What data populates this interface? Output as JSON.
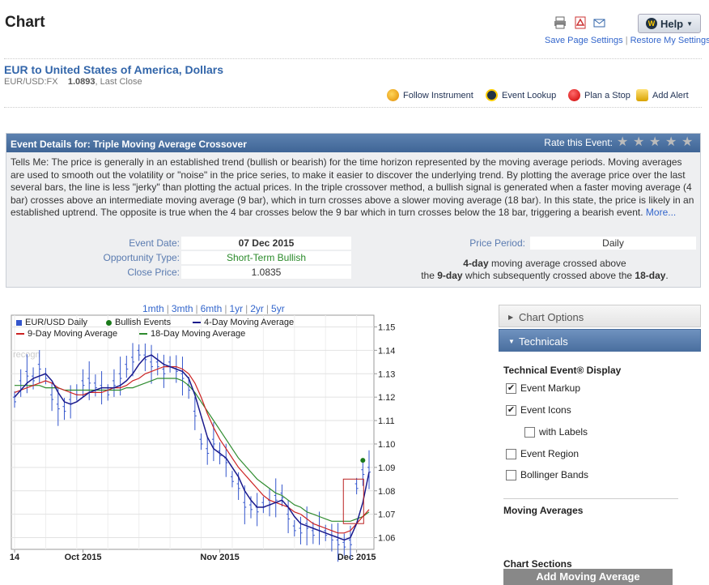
{
  "page": {
    "title": "Chart",
    "help_label": "Help",
    "save_settings": "Save Page Settings",
    "restore_settings": "Restore My Settings",
    "separator": "|"
  },
  "instrument": {
    "name": "EUR to United States of America, Dollars",
    "symbol": "EUR/USD:FX",
    "price": "1.0893",
    "price_note": ", Last Close"
  },
  "actions": [
    {
      "label": "Follow Instrument",
      "icon": "follow-icon"
    },
    {
      "label": "Event Lookup",
      "icon": "event-lookup-icon"
    },
    {
      "label": "Plan a Stop",
      "icon": "stop-icon"
    },
    {
      "label": "Add Alert",
      "icon": "alert-bell-icon"
    }
  ],
  "event": {
    "header": "Event Details for: Triple Moving Average Crossover",
    "rate_label": "Rate this Event:",
    "description": "Tells Me: The price is generally in an established trend (bullish or bearish) for the time horizon represented by the moving average periods. Moving averages are used to smooth out the volatility or \"noise\" in the price series, to make it easier to discover the underlying trend. By plotting the average price over the last several bars, the line is less \"jerky\" than plotting the actual prices. In the triple crossover method, a bullish signal is generated when a faster moving average (4 bar) crosses above an intermediate moving average (9 bar), which in turn crosses above a slower moving average (18 bar). In this state, the price is likely in an established uptrend. The opposite is true when the 4 bar crosses below the 9 bar which in turn crosses below the 18 bar, triggering a bearish event.",
    "more": "More...",
    "fields": {
      "date_label": "Event Date:",
      "date": "07 Dec 2015",
      "opp_label": "Opportunity Type:",
      "opp": "Short-Term Bullish",
      "close_label": "Close Price:",
      "close": "1.0835",
      "period_label": "Price Period:",
      "period": "Daily"
    },
    "summary": {
      "p1": "4-day",
      "t1": " moving average crossed above",
      "t2": "the ",
      "p2": "9-day",
      "t3": " which subsequently crossed above the ",
      "p3": "18-day",
      "t4": "."
    }
  },
  "ranges": [
    "1mth",
    "3mth",
    "6mth",
    "1yr",
    "2yr",
    "5yr"
  ],
  "legend": [
    "EUR/USD Daily",
    "Bullish Events",
    "4-Day Moving Average",
    "9-Day Moving Average",
    "18-Day Moving Average"
  ],
  "colors": {
    "price": "#3355cc",
    "ma4": "#1a1a8c",
    "ma9": "#cc2222",
    "ma18": "#2e8b2e",
    "event": "#1a7a1a"
  },
  "chart_data": {
    "type": "line",
    "y_ticks": [
      "1.15",
      "1.14",
      "1.13",
      "1.12",
      "1.11",
      "1.10",
      "1.09",
      "1.08",
      "1.07",
      "1.06"
    ],
    "ylim": [
      1.055,
      1.155
    ],
    "x_ticks": [
      {
        "label": "14",
        "i": 0
      },
      {
        "label": "Oct 2015",
        "i": 11
      },
      {
        "label": "Nov 2015",
        "i": 33
      },
      {
        "label": "Dec 2015",
        "i": 55
      }
    ],
    "watermark": "recogn",
    "series": [
      {
        "name": "EUR/USD Daily",
        "values": [
          1.119,
          1.126,
          1.13,
          1.128,
          1.133,
          1.129,
          1.12,
          1.116,
          1.115,
          1.118,
          1.122,
          1.126,
          1.127,
          1.125,
          1.124,
          1.122,
          1.126,
          1.129,
          1.133,
          1.136,
          1.139,
          1.137,
          1.134,
          1.134,
          1.131,
          1.134,
          1.132,
          1.129,
          1.124,
          1.113,
          1.101,
          1.097,
          1.101,
          1.096,
          1.093,
          1.085,
          1.082,
          1.074,
          1.073,
          1.072,
          1.074,
          1.075,
          1.077,
          1.078,
          1.069,
          1.064,
          1.063,
          1.065,
          1.062,
          1.064,
          1.062,
          1.06,
          1.058,
          1.057,
          1.058,
          1.082,
          1.088,
          1.089
        ]
      },
      {
        "name": "4-Day Moving Average",
        "values": [
          1.12,
          1.123,
          1.126,
          1.128,
          1.129,
          1.13,
          1.127,
          1.122,
          1.118,
          1.117,
          1.118,
          1.12,
          1.122,
          1.123,
          1.124,
          1.124,
          1.124,
          1.125,
          1.127,
          1.13,
          1.134,
          1.137,
          1.138,
          1.136,
          1.134,
          1.133,
          1.132,
          1.131,
          1.128,
          1.121,
          1.112,
          1.103,
          1.098,
          1.096,
          1.094,
          1.09,
          1.086,
          1.08,
          1.076,
          1.073,
          1.073,
          1.074,
          1.075,
          1.076,
          1.073,
          1.069,
          1.066,
          1.065,
          1.064,
          1.063,
          1.062,
          1.061,
          1.06,
          1.059,
          1.06,
          1.066,
          1.075,
          1.088
        ]
      },
      {
        "name": "9-Day Moving Average",
        "values": [
          1.122,
          1.123,
          1.124,
          1.125,
          1.126,
          1.127,
          1.126,
          1.124,
          1.123,
          1.122,
          1.121,
          1.121,
          1.122,
          1.122,
          1.122,
          1.123,
          1.124,
          1.124,
          1.125,
          1.127,
          1.128,
          1.13,
          1.131,
          1.132,
          1.133,
          1.133,
          1.133,
          1.132,
          1.13,
          1.126,
          1.12,
          1.113,
          1.107,
          1.102,
          1.098,
          1.094,
          1.09,
          1.087,
          1.084,
          1.081,
          1.078,
          1.076,
          1.075,
          1.074,
          1.073,
          1.071,
          1.07,
          1.068,
          1.066,
          1.065,
          1.064,
          1.063,
          1.062,
          1.062,
          1.063,
          1.066,
          1.069,
          1.072
        ]
      },
      {
        "name": "18-Day Moving Average",
        "values": [
          1.125,
          1.125,
          1.125,
          1.125,
          1.125,
          1.124,
          1.124,
          1.124,
          1.123,
          1.123,
          1.123,
          1.123,
          1.123,
          1.123,
          1.123,
          1.123,
          1.123,
          1.123,
          1.124,
          1.124,
          1.125,
          1.126,
          1.127,
          1.128,
          1.128,
          1.128,
          1.128,
          1.127,
          1.125,
          1.122,
          1.118,
          1.114,
          1.11,
          1.106,
          1.102,
          1.098,
          1.094,
          1.091,
          1.088,
          1.085,
          1.083,
          1.081,
          1.079,
          1.078,
          1.076,
          1.074,
          1.073,
          1.071,
          1.07,
          1.069,
          1.068,
          1.067,
          1.067,
          1.067,
          1.067,
          1.068,
          1.069,
          1.071
        ]
      }
    ],
    "events": [
      {
        "i": 56,
        "y": 1.093
      }
    ]
  },
  "panel": {
    "chart_options": "Chart Options",
    "technicals": "Technicals",
    "ted_heading": "Technical Event® Display",
    "checks": [
      {
        "label": "Event Markup",
        "checked": true
      },
      {
        "label": "Event Icons",
        "checked": true
      },
      {
        "label": "with Labels",
        "checked": false
      },
      {
        "label": "Event Region",
        "checked": false
      },
      {
        "label": "Bollinger Bands",
        "checked": false
      }
    ],
    "ma_heading": "Moving Averages",
    "add_ma": "Add Moving Average",
    "sections_heading": "Chart Sections"
  }
}
